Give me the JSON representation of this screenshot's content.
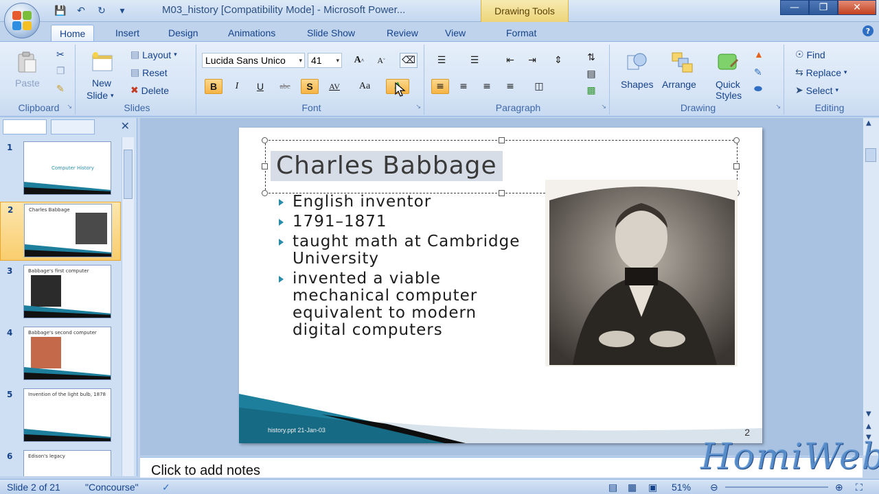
{
  "window": {
    "title": "M03_history [Compatibility Mode] - Microsoft Power...",
    "contextual_tab_group": "Drawing Tools"
  },
  "tabs": [
    "Home",
    "Insert",
    "Design",
    "Animations",
    "Slide Show",
    "Review",
    "View",
    "Format"
  ],
  "active_tab": "Home",
  "ribbon": {
    "clipboard": {
      "label": "Clipboard",
      "paste": "Paste"
    },
    "slides": {
      "label": "Slides",
      "new_slide_line1": "New",
      "new_slide_line2": "Slide",
      "layout": "Layout",
      "reset": "Reset",
      "delete": "Delete"
    },
    "font": {
      "label": "Font",
      "font_name": "Lucida Sans Unico",
      "font_size": "41",
      "bold": "B",
      "italic": "I",
      "underline": "U",
      "strike": "abc",
      "shadow": "S",
      "spacing": "AV",
      "change_case": "Aa",
      "grow": "A",
      "shrink": "A"
    },
    "paragraph": {
      "label": "Paragraph"
    },
    "drawing": {
      "label": "Drawing",
      "shapes": "Shapes",
      "arrange": "Arrange",
      "quick_styles_line1": "Quick",
      "quick_styles_line2": "Styles"
    },
    "editing": {
      "label": "Editing",
      "find": "Find",
      "replace": "Replace",
      "select": "Select"
    }
  },
  "slides_panel": {
    "thumbnails": [
      {
        "num": "1",
        "title": "Computer History"
      },
      {
        "num": "2",
        "title": "Charles Babbage"
      },
      {
        "num": "3",
        "title": "Babbage's first computer"
      },
      {
        "num": "4",
        "title": "Babbage's second computer"
      },
      {
        "num": "5",
        "title": "Invention of the light bulb, 1878"
      },
      {
        "num": "6",
        "title": "Edison's legacy"
      }
    ]
  },
  "slide": {
    "title": "Charles Babbage",
    "bullets": [
      "English inventor",
      "1791–1871",
      "taught math at Cambridge University",
      "invented a viable mechanical computer equivalent to modern digital computers"
    ],
    "footer": "history.ppt   21-Jan-03",
    "number": "2"
  },
  "notes_placeholder": "Click to add notes",
  "status": {
    "slide_info": "Slide 2 of 21",
    "theme": "\"Concourse\"",
    "zoom": "51%"
  },
  "watermark": "HomiWebs",
  "colors": {
    "accent": "#2a8cab",
    "ribbon_bg": "#d6e4f6",
    "title_highlight": "#d7dde7"
  }
}
